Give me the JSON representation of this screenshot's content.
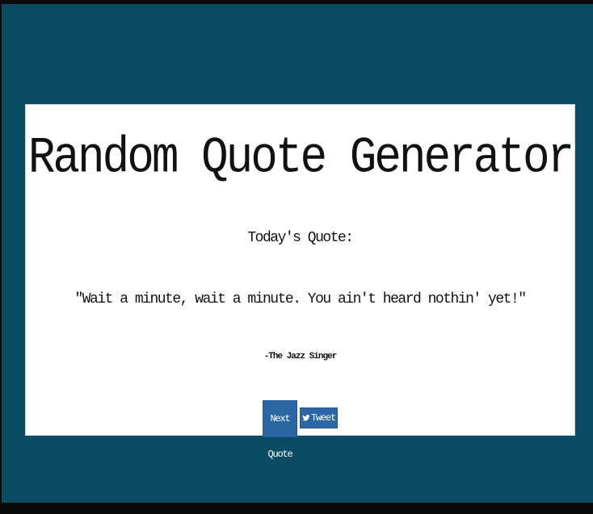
{
  "app": {
    "title": "Random Quote Generator"
  },
  "colors": {
    "page_background": "#0a4c63",
    "card_background": "#ffffff",
    "button_background": "#2c67a5"
  },
  "quote_section": {
    "label": "Today's Quote:",
    "text": "\"Wait a minute, wait a minute. You ain't heard nothin' yet!\"",
    "author": "-The Jazz Singer"
  },
  "actions": {
    "next_label": "Next Quote",
    "tweet_label": "Tweet",
    "tweet_icon": "twitter-bird-icon"
  }
}
